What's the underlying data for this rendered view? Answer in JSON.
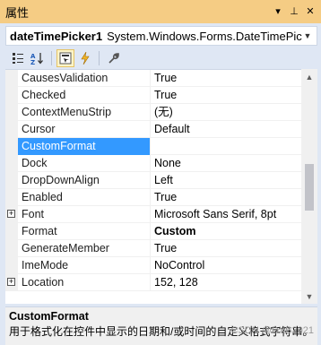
{
  "panel": {
    "title": "属性",
    "pin_glyph": "▾",
    "pin2_glyph": "⊥",
    "close_glyph": "✕"
  },
  "object_selector": {
    "name": "dateTimePicker1",
    "type": "System.Windows.Forms.DateTimePic"
  },
  "toolbar": {
    "buttons": [
      "categorized-icon",
      "alphabetical-icon",
      "properties-icon",
      "events-icon",
      "property-pages-icon"
    ],
    "active": "properties-icon"
  },
  "properties": [
    {
      "name": "CausesValidation",
      "value": "True"
    },
    {
      "name": "Checked",
      "value": "True"
    },
    {
      "name": "ContextMenuStrip",
      "value": "(无)"
    },
    {
      "name": "Cursor",
      "value": "Default"
    },
    {
      "name": "CustomFormat",
      "value": "",
      "selected": true
    },
    {
      "name": "Dock",
      "value": "None"
    },
    {
      "name": "DropDownAlign",
      "value": "Left"
    },
    {
      "name": "Enabled",
      "value": "True"
    },
    {
      "name": "Font",
      "value": "Microsoft Sans Serif, 8pt",
      "expandable": true
    },
    {
      "name": "Format",
      "value": "Custom",
      "bold": true
    },
    {
      "name": "GenerateMember",
      "value": "True"
    },
    {
      "name": "ImeMode",
      "value": "NoControl"
    },
    {
      "name": "Location",
      "value": "152, 128",
      "expandable": true
    }
  ],
  "description": {
    "title": "CustomFormat",
    "text": "用于格式化在控件中显示的日期和/或时间的自定义格式字符串。"
  },
  "watermark": "CSDN @DXB2021",
  "colors": {
    "title_bar": "#f5cc84",
    "frame": "#dfe7f4",
    "selection": "#3399ff"
  }
}
